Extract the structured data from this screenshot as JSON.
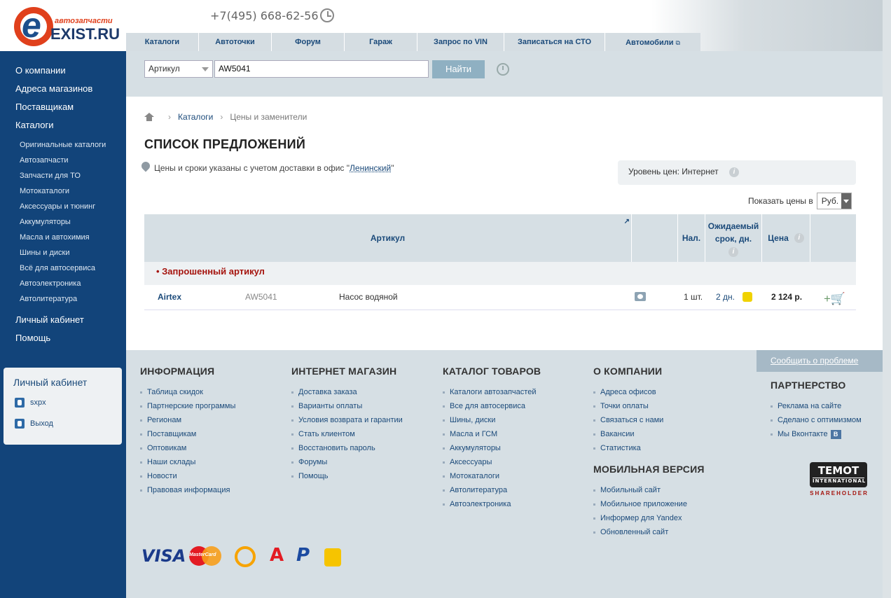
{
  "header": {
    "logo_small": "автозапчасти",
    "logo_big": "EXIST.RU",
    "phone": "+7(495) 668-62-56"
  },
  "topnav": [
    {
      "label": "Каталоги"
    },
    {
      "label": "Автоточки"
    },
    {
      "label": "Форум"
    },
    {
      "label": "Гараж"
    },
    {
      "label": "Запрос по VIN"
    },
    {
      "label": "Записаться на СТО"
    },
    {
      "label": "Автомобили"
    }
  ],
  "search": {
    "type_selected": "Артикул",
    "value": "AW5041",
    "button": "Найти"
  },
  "sidebar": {
    "main_top": [
      "О компании",
      "Адреса магазинов",
      "Поставщикам",
      "Каталоги"
    ],
    "sub": [
      "Оригинальные каталоги",
      "Автозапчасти",
      "Запчасти для ТО",
      "Мотокаталоги",
      "Аксессуары и тюнинг",
      "Аккумуляторы",
      "Масла и автохимия",
      "Шины и диски",
      "Всё для автосервиса",
      "Автоэлектроника",
      "Автолитература"
    ],
    "main_bottom": [
      "Личный кабинет",
      "Помощь"
    ],
    "cabinet": {
      "title": "Личный кабинет",
      "user": "sxpx",
      "logout": "Выход"
    }
  },
  "breadcrumb": {
    "catalogs": "Каталоги",
    "current": "Цены и заменители"
  },
  "page_title": "СПИСОК ПРЕДЛОЖЕНИЙ",
  "delivery": {
    "text": "Цены и сроки указаны с учетом доставки в офис \"",
    "office": "Ленинский",
    "close": "\""
  },
  "price_level": {
    "label": "Уровень цен: Интернет"
  },
  "show_prices": {
    "label": "Показать цены в",
    "currency": "Руб."
  },
  "table": {
    "headers": {
      "article": "Артикул",
      "stock": "Нал.",
      "expected": "Ожидаемый срок, дн.",
      "price": "Цена"
    },
    "requested": "• Запрошенный артикул",
    "rows": [
      {
        "brand": "Airtex",
        "code": "AW5041",
        "name": "Насос водяной",
        "qty": "1 шт.",
        "days": "2 дн.",
        "price": "2 124 р."
      }
    ]
  },
  "footer": {
    "report": "Сообщить о проблеме",
    "info": {
      "title": "ИНФОРМАЦИЯ",
      "links": [
        "Таблица скидок",
        "Партнерские программы",
        "Регионам",
        "Поставщикам",
        "Оптовикам",
        "Наши склады",
        "Новости",
        "Правовая информация"
      ]
    },
    "shop": {
      "title": "ИНТЕРНЕТ МАГАЗИН",
      "links": [
        "Доставка заказа",
        "Варианты оплаты",
        "Условия возврата и гарантии",
        "Стать клиентом",
        "Восстановить пароль",
        "Форумы",
        "Помощь"
      ]
    },
    "catalog": {
      "title": "КАТАЛОГ ТОВАРОВ",
      "links": [
        "Каталоги автозапчастей",
        "Все для автосервиса",
        "Шины, диски",
        "Масла и ГСМ",
        "Аккумуляторы",
        "Аксессуары",
        "Мотокаталоги",
        "Автолитература",
        "Автоэлектроника"
      ]
    },
    "about": {
      "title": "О КОМПАНИИ",
      "links": [
        "Адреса офисов",
        "Точки оплаты",
        "Связаться с нами",
        "Вакансии",
        "Статистика"
      ]
    },
    "mobile": {
      "title": "МОБИЛЬНАЯ ВЕРСИЯ",
      "links": [
        "Мобильный сайт",
        "Мобильное приложение",
        "Информер для Yandex",
        "Обновленный сайт"
      ]
    },
    "partners": {
      "title": "ПАРТНЕРСТВО",
      "links": [
        "Реклама на сайте",
        "Сделано с оптимизмом",
        "Мы Вконтакте"
      ]
    },
    "temot": {
      "name": "TEMOT",
      "sub": "INTERNATIONAL",
      "shareholder": "SHAREHOLDER"
    },
    "payments": {
      "visa": "VISA",
      "mastercard": "MasterCard"
    }
  }
}
